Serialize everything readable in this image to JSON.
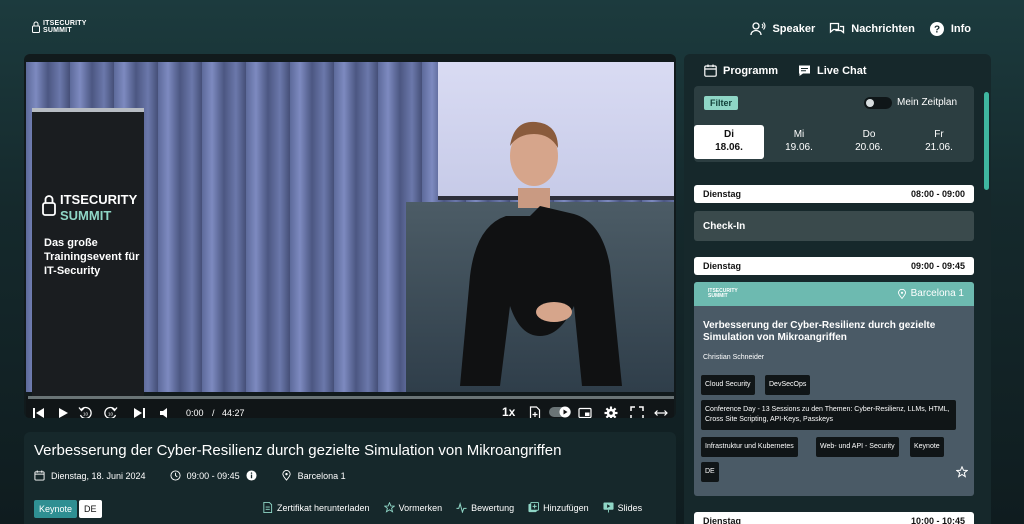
{
  "brand": {
    "line1": "ITSECURITY",
    "line2": "SUMMIT"
  },
  "nav": {
    "speaker": "Speaker",
    "messages": "Nachrichten",
    "info": "Info"
  },
  "video": {
    "current_time": "0:00",
    "separator": "/",
    "duration": "44:27",
    "speed": "1x",
    "progress": 0,
    "banner": {
      "line1": "ITSECURITY",
      "line2": "SUMMIT",
      "tagline": "Das große Trainingsevent für IT-Security"
    }
  },
  "talk": {
    "title": "Verbesserung der Cyber-Resilienz durch gezielte Simulation von Mikroangriffen",
    "date": "Dienstag, 18. Juni 2024",
    "time": "09:00 - 09:45",
    "room": "Barcelona 1",
    "tag_type": "Keynote",
    "tag_lang": "DE",
    "actions": {
      "certificate": "Zertifikat herunterladen",
      "bookmark": "Vormerken",
      "rating": "Bewertung",
      "add": "Hinzufügen",
      "slides": "Slides"
    }
  },
  "sidebar": {
    "tab_program": "Programm",
    "tab_chat": "Live Chat",
    "filter": "Filter",
    "my_schedule": "Mein Zeitplan",
    "days": [
      {
        "name": "Di",
        "date": "18.06."
      },
      {
        "name": "Mi",
        "date": "19.06."
      },
      {
        "name": "Do",
        "date": "20.06."
      },
      {
        "name": "Fr",
        "date": "21.06."
      }
    ],
    "slots": [
      {
        "day": "Dienstag",
        "time": "08:00 - 09:00"
      },
      {
        "day": "Dienstag",
        "time": "09:00 - 09:45"
      },
      {
        "day": "Dienstag",
        "time": "10:00 - 10:45"
      }
    ],
    "checkin": "Check-In",
    "session": {
      "logo1": "ITSECURITY",
      "logo2": "SUMMIT",
      "room": "Barcelona 1",
      "title": "Verbesserung der Cyber-Resilienz durch gezielte Simulation von Mikroangriffen",
      "speaker": "Christian Schneider",
      "chips": [
        "Cloud Security",
        "DevSecOps",
        "Conference Day - 13 Sessions zu den Themen: Cyber-Resilienz, LLMs, HTML, Cross Site Scripting, API-Keys, Passkeys",
        "Infrastruktur und Kubernetes",
        "Web- und API - Security",
        "Keynote",
        "DE"
      ]
    }
  },
  "colors": {
    "accent": "#8fd6c6",
    "teal": "#2f8f92",
    "card_head": "#6dbab0"
  }
}
